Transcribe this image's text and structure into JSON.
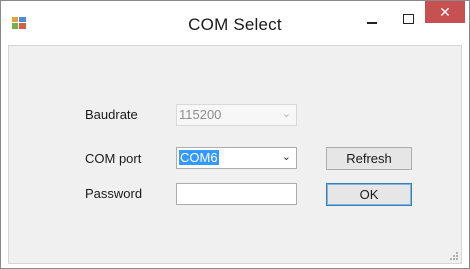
{
  "window": {
    "title": "COM Select",
    "close_glyph": "✕",
    "icons": {
      "app": "application-icon",
      "minimize": "minimize-icon",
      "maximize": "maximize-icon",
      "close": "close-icon"
    }
  },
  "form": {
    "baudrate_label": "Baudrate",
    "baudrate_value": "115200",
    "comport_label": "COM port",
    "comport_value": "COM6",
    "password_label": "Password",
    "password_value": "",
    "refresh_label": "Refresh",
    "ok_label": "OK"
  },
  "colors": {
    "close_button": "#c75050",
    "selection": "#3399ff",
    "client_background": "#f0f0f0"
  }
}
